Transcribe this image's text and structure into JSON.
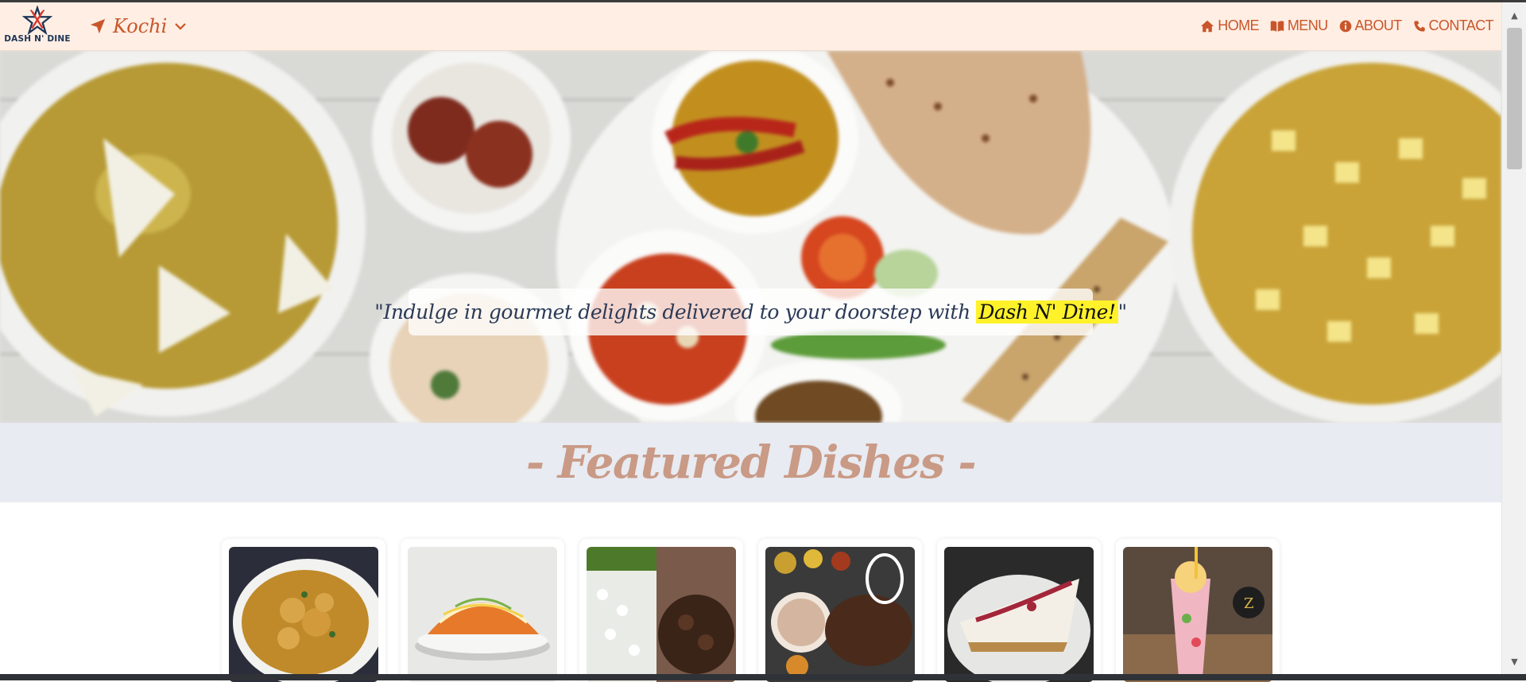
{
  "brand": {
    "logo_text": "DASH N' DINE"
  },
  "location": {
    "city": "Kochi"
  },
  "nav": {
    "items": [
      {
        "label": "HOME",
        "icon": "home-icon"
      },
      {
        "label": "MENU",
        "icon": "book-icon"
      },
      {
        "label": "ABOUT",
        "icon": "info-icon"
      },
      {
        "label": "CONTACT",
        "icon": "phone-icon"
      }
    ]
  },
  "hero": {
    "quote_before": "\"Indulge in gourmet delights delivered to your doorstep with ",
    "quote_highlight": "Dash N' Dine!",
    "quote_after": "\""
  },
  "featured": {
    "title": "- Featured Dishes -"
  },
  "dishes": [
    {
      "image": "chicken-curry-image"
    },
    {
      "image": "loaded-fries-image"
    },
    {
      "image": "rice-and-beef-fry-image"
    },
    {
      "image": "thali-meal-image"
    },
    {
      "image": "cheesecake-image"
    },
    {
      "image": "falooda-drink-image"
    }
  ],
  "colors": {
    "accent": "#c9562b",
    "navbar_bg": "#ffeee3",
    "featured_bg": "#e8ebf1",
    "featured_title": "#c99a86",
    "highlight": "#fff22b",
    "quote_text": "#2b3a57"
  }
}
